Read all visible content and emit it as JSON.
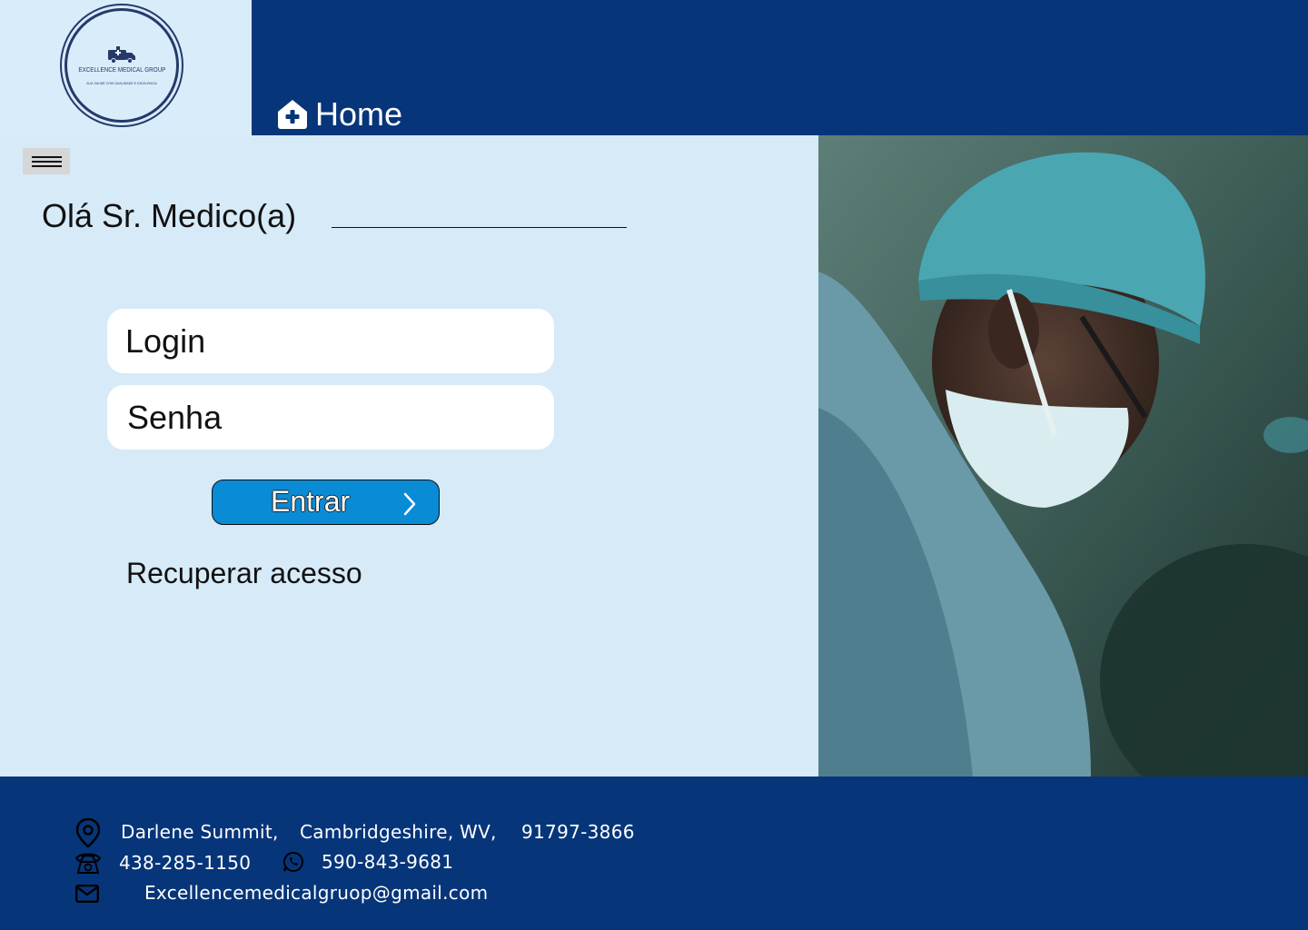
{
  "logo": {
    "name": "EXCELLENCE MEDICAL GROUP",
    "tagline": "SUA SAUDE COM QUALIDADE E EXCELENCIA"
  },
  "nav": {
    "home_label": "Home"
  },
  "greeting": "Olá Sr. Medico(a)",
  "form": {
    "login_placeholder": "Login",
    "password_placeholder": "Senha",
    "submit_label": "Entrar",
    "recover_label": "Recuperar acesso"
  },
  "footer": {
    "address": {
      "street": "Darlene Summit,",
      "city": "Cambridgeshire,",
      "state": "WV,",
      "zip": "91797-3866"
    },
    "phone": "438-285-1150",
    "whatsapp": "590-843-9681",
    "email": "Excellencemedicalgruop@gmail.com"
  },
  "colors": {
    "header_bg": "#07357a",
    "page_bg": "#d6eaf8",
    "accent_button": "#0a8bd6"
  },
  "icons": [
    "home-plus-icon",
    "hamburger-menu-icon",
    "chevron-right-icon",
    "location-pin-icon",
    "telephone-icon",
    "whatsapp-icon",
    "mail-icon"
  ]
}
